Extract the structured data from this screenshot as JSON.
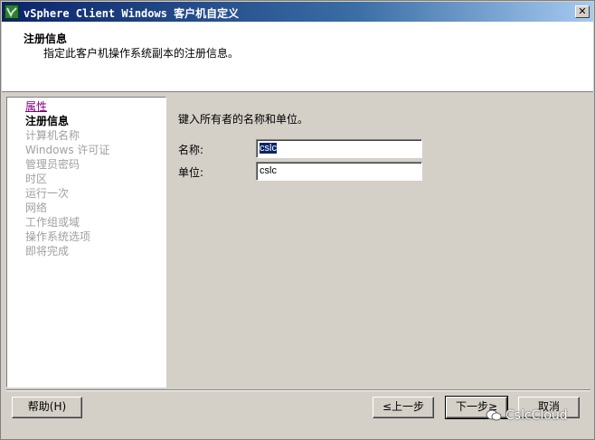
{
  "window": {
    "title": "vSphere Client Windows 客户机自定义",
    "close_glyph": "✕"
  },
  "header": {
    "title": "注册信息",
    "subtitle": "指定此客户机操作系统副本的注册信息。"
  },
  "sidebar": {
    "items": [
      {
        "label": "属性",
        "state": "link"
      },
      {
        "label": "注册信息",
        "state": "current"
      },
      {
        "label": "计算机名称",
        "state": "disabled"
      },
      {
        "label": "Windows 许可证",
        "state": "disabled"
      },
      {
        "label": "管理员密码",
        "state": "disabled"
      },
      {
        "label": "时区",
        "state": "disabled"
      },
      {
        "label": "运行一次",
        "state": "disabled"
      },
      {
        "label": "网络",
        "state": "disabled"
      },
      {
        "label": "工作组或域",
        "state": "disabled"
      },
      {
        "label": "操作系统选项",
        "state": "disabled"
      },
      {
        "label": "即将完成",
        "state": "disabled"
      }
    ]
  },
  "main": {
    "instruction": "键入所有者的名称和单位。",
    "name_label": "名称:",
    "name_value": "cslc",
    "org_label": "单位:",
    "org_value": "cslc"
  },
  "buttons": {
    "help": "帮助(H)",
    "back": "≤上一步",
    "next": "下一步≥",
    "cancel": "取消"
  },
  "watermark": {
    "text": "CslcCloud"
  },
  "colors": {
    "titlebar_start": "#0a246a",
    "titlebar_end": "#a6caf0",
    "dialog_bg": "#d4d0c8",
    "link": "#800080",
    "disabled": "#a0a0a0"
  }
}
